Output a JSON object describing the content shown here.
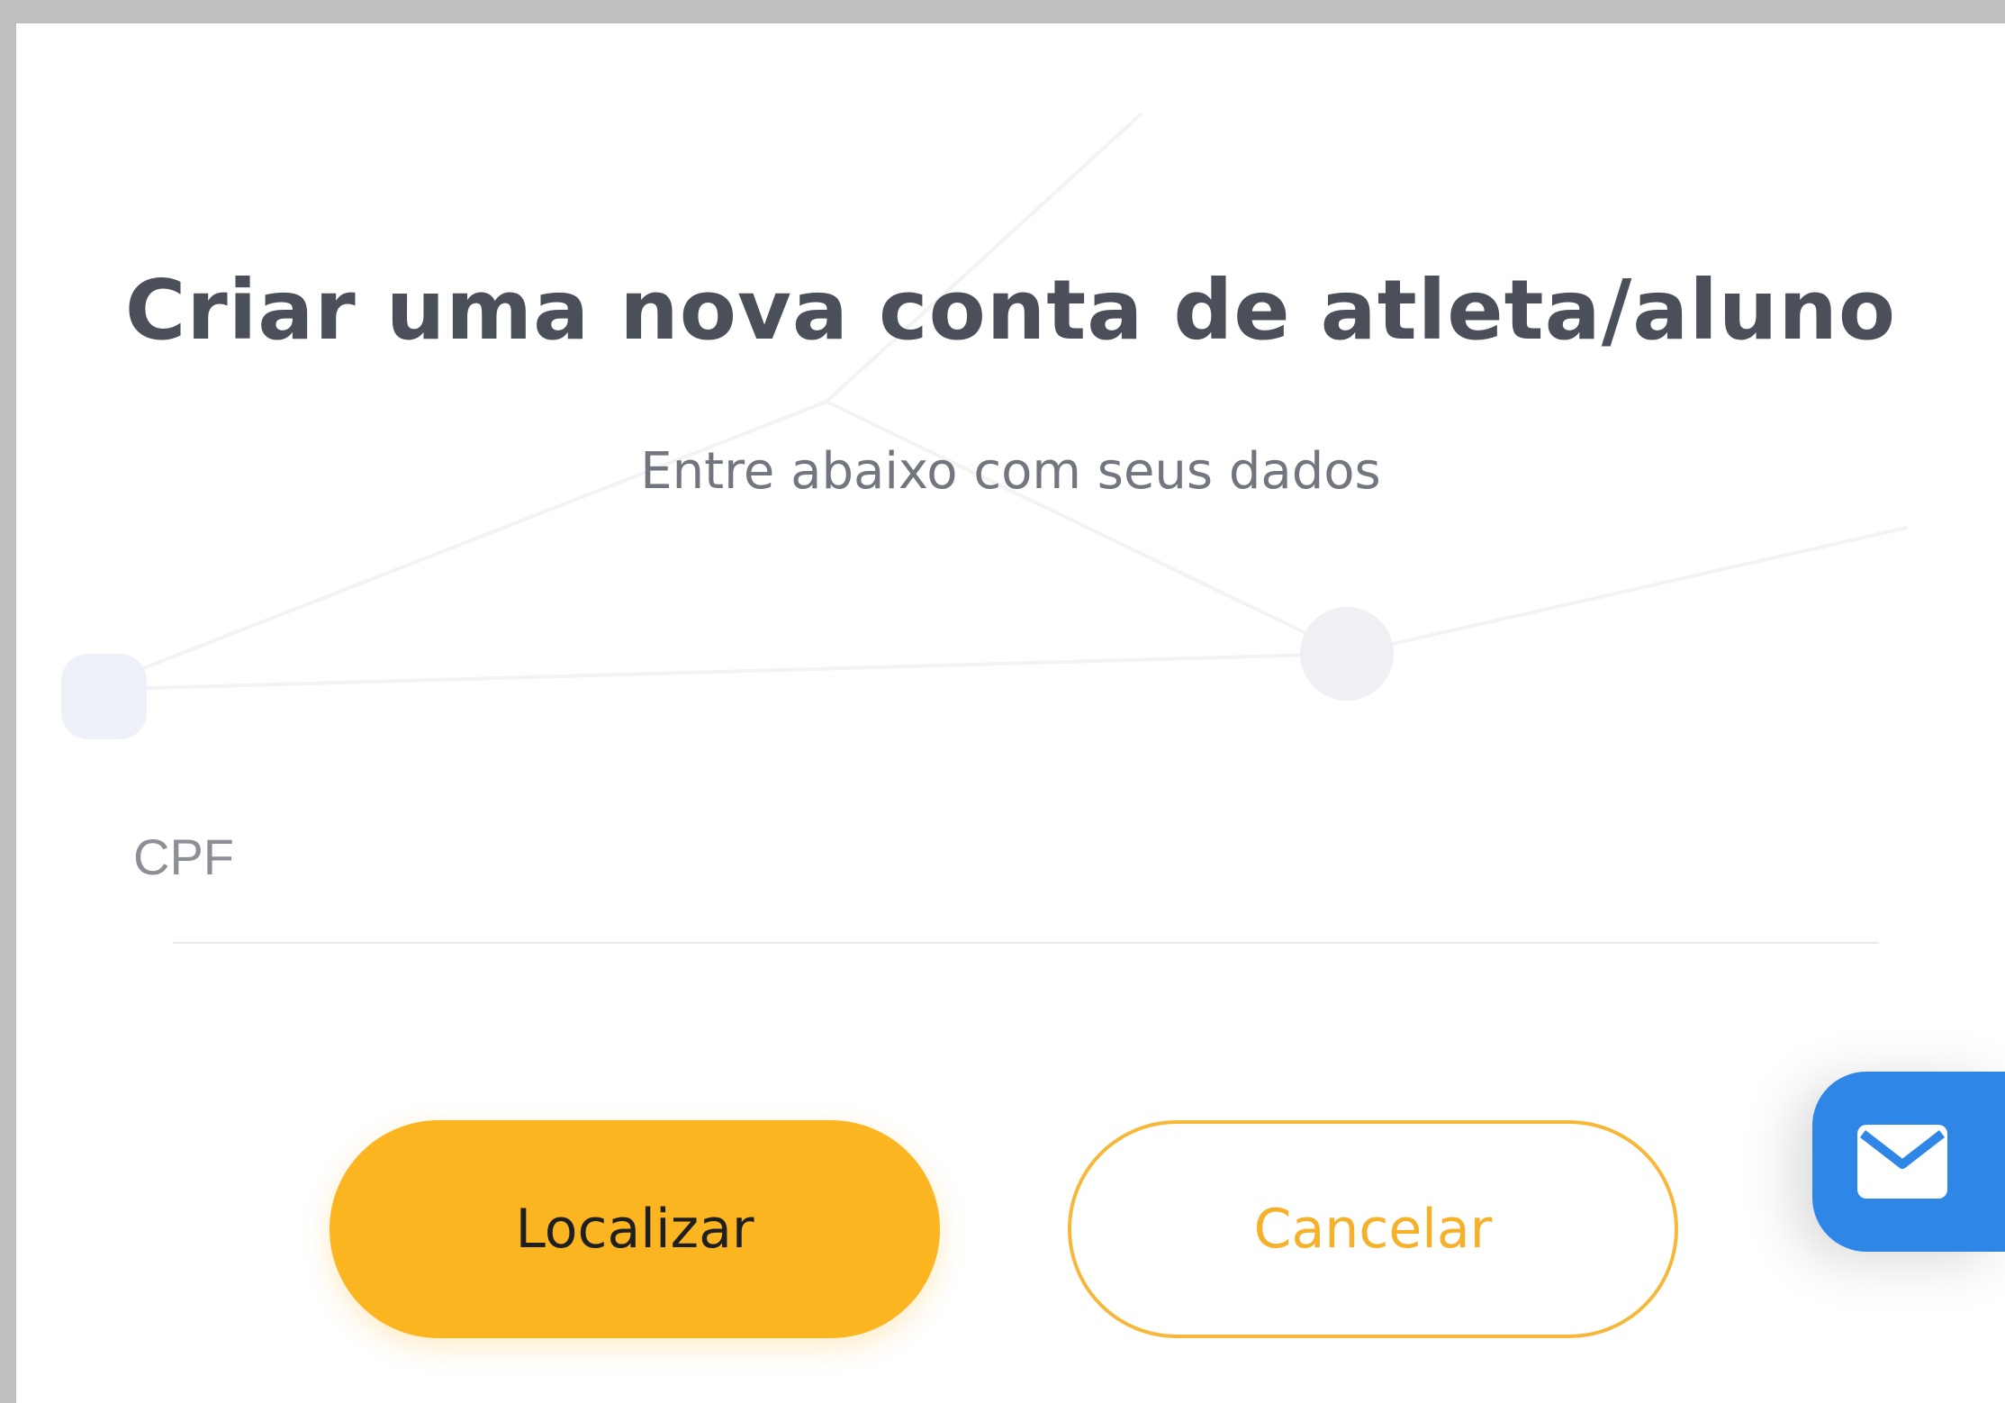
{
  "dialog": {
    "title": "Criar uma nova conta de atleta/aluno",
    "subtitle": "Entre abaixo com seus dados"
  },
  "form": {
    "cpf_label": "CPF",
    "cpf_value": ""
  },
  "actions": {
    "primary_label": "Localizar",
    "secondary_label": "Cancelar"
  },
  "fab": {
    "icon": "mail-icon"
  },
  "colors": {
    "accent": "#fbb520",
    "fab": "#2e86e6",
    "title": "#4b4f5a"
  }
}
